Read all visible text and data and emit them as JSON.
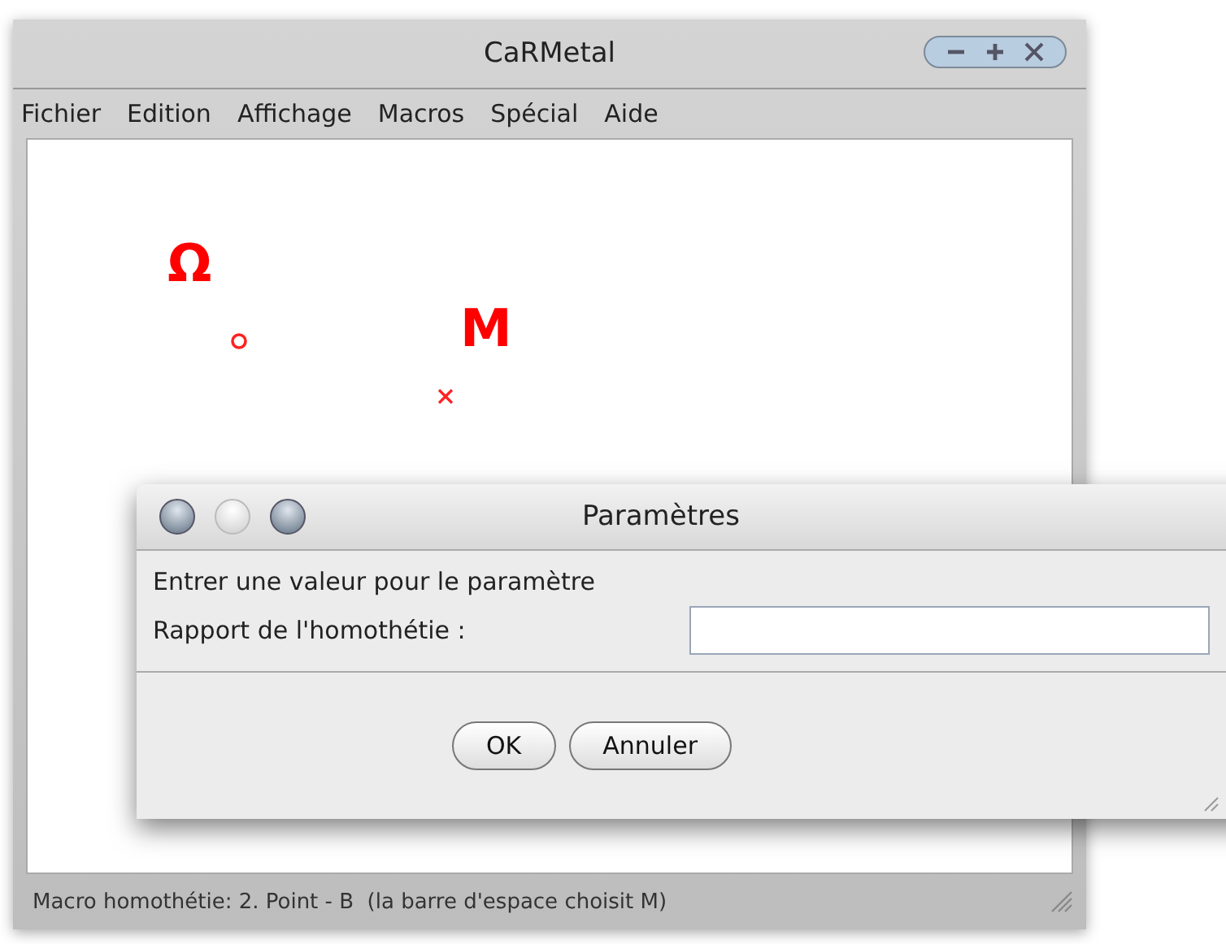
{
  "window": {
    "title": "CaRMetal"
  },
  "menu": [
    "Fichier",
    "Edition",
    "Affichage",
    "Macros",
    "Spécial",
    "Aide"
  ],
  "canvas": {
    "points": [
      {
        "label": "Ω",
        "kind": "circle"
      },
      {
        "label": "M",
        "kind": "cross"
      }
    ]
  },
  "dialog": {
    "title": "Paramètres",
    "message": "Entrer une valeur pour le paramètre",
    "field_label": "Rapport de l'homothétie :",
    "buttons": [
      "OK",
      "Annuler"
    ]
  },
  "status_bar": "Macro homothétie: 2. Point - B  (la barre d'espace choisit M)"
}
